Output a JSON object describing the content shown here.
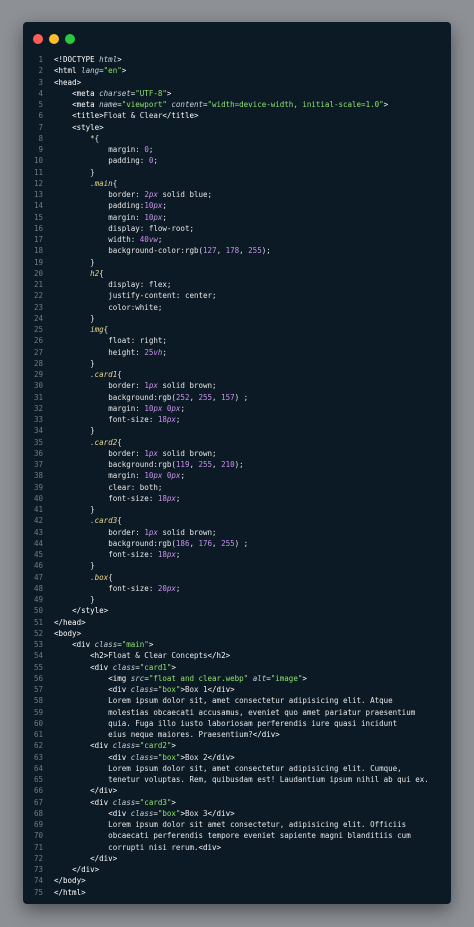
{
  "window": {
    "title": "",
    "traffic_lights": [
      {
        "name": "close",
        "color": "#ff5f57"
      },
      {
        "name": "minimize",
        "color": "#febc2e"
      },
      {
        "name": "maximize",
        "color": "#28c840"
      }
    ]
  },
  "colors": {
    "line_number": "#6b7b8c",
    "background": "#0c1a25",
    "string": "#8fe36f",
    "selector": "#e8d890",
    "number": "#c792ea"
  },
  "code_lines": [
    [
      [
        "tag",
        "<!DOCTYPE "
      ],
      [
        "attr",
        "html"
      ],
      [
        "tag",
        ">"
      ]
    ],
    [
      [
        "tag",
        "<html "
      ],
      [
        "attr",
        "lang"
      ],
      [
        "punct",
        "="
      ],
      [
        "str",
        "\"en\""
      ],
      [
        "tag",
        ">"
      ]
    ],
    [
      [
        "tag",
        "<head>"
      ]
    ],
    [
      [
        "plain",
        "    "
      ],
      [
        "tag",
        "<meta "
      ],
      [
        "attr",
        "charset"
      ],
      [
        "punct",
        "="
      ],
      [
        "str",
        "\"UTF-8\""
      ],
      [
        "tag",
        ">"
      ]
    ],
    [
      [
        "plain",
        "    "
      ],
      [
        "tag",
        "<meta "
      ],
      [
        "attr",
        "name"
      ],
      [
        "punct",
        "="
      ],
      [
        "str",
        "\"viewport\""
      ],
      [
        "plain",
        " "
      ],
      [
        "attr",
        "content"
      ],
      [
        "punct",
        "="
      ],
      [
        "str",
        "\"width=device-width, initial-scale=1.0\""
      ],
      [
        "tag",
        ">"
      ]
    ],
    [
      [
        "plain",
        "    "
      ],
      [
        "tag",
        "<title>"
      ],
      [
        "plain",
        "Float & Clear"
      ],
      [
        "tag",
        "</title>"
      ]
    ],
    [
      [
        "plain",
        "    "
      ],
      [
        "tag",
        "<style>"
      ]
    ],
    [
      [
        "plain",
        "        "
      ],
      [
        "sel",
        "*"
      ],
      [
        "punct",
        "{"
      ]
    ],
    [
      [
        "plain",
        "            "
      ],
      [
        "prop",
        "margin: "
      ],
      [
        "num",
        "0"
      ],
      [
        "punct",
        ";"
      ]
    ],
    [
      [
        "plain",
        "            "
      ],
      [
        "prop",
        "padding: "
      ],
      [
        "num",
        "0"
      ],
      [
        "punct",
        ";"
      ]
    ],
    [
      [
        "plain",
        "        "
      ],
      [
        "punct",
        "}"
      ]
    ],
    [
      [
        "plain",
        "        "
      ],
      [
        "sel",
        ".main"
      ],
      [
        "punct",
        "{"
      ]
    ],
    [
      [
        "plain",
        "            "
      ],
      [
        "prop",
        "border: "
      ],
      [
        "num",
        "2"
      ],
      [
        "unit",
        "px"
      ],
      [
        "prop",
        " solid blue;"
      ]
    ],
    [
      [
        "plain",
        "            "
      ],
      [
        "prop",
        "padding:"
      ],
      [
        "num",
        "10"
      ],
      [
        "unit",
        "px"
      ],
      [
        "punct",
        ";"
      ]
    ],
    [
      [
        "plain",
        "            "
      ],
      [
        "prop",
        "margin: "
      ],
      [
        "num",
        "10"
      ],
      [
        "unit",
        "px"
      ],
      [
        "punct",
        ";"
      ]
    ],
    [
      [
        "plain",
        "            "
      ],
      [
        "prop",
        "display: flow-root;"
      ]
    ],
    [
      [
        "plain",
        "            "
      ],
      [
        "prop",
        "width: "
      ],
      [
        "num",
        "40"
      ],
      [
        "unit",
        "vw"
      ],
      [
        "punct",
        ";"
      ]
    ],
    [
      [
        "plain",
        "            "
      ],
      [
        "prop",
        "background-color:rgb("
      ],
      [
        "num",
        "127"
      ],
      [
        "prop",
        ", "
      ],
      [
        "num",
        "178"
      ],
      [
        "prop",
        ", "
      ],
      [
        "num",
        "255"
      ],
      [
        "prop",
        ");"
      ]
    ],
    [
      [
        "plain",
        "        "
      ],
      [
        "punct",
        "}"
      ]
    ],
    [
      [
        "plain",
        "        "
      ],
      [
        "sel",
        "h2"
      ],
      [
        "punct",
        "{"
      ]
    ],
    [
      [
        "plain",
        "            "
      ],
      [
        "prop",
        "display: flex;"
      ]
    ],
    [
      [
        "plain",
        "            "
      ],
      [
        "prop",
        "justify-content: center;"
      ]
    ],
    [
      [
        "plain",
        "            "
      ],
      [
        "prop",
        "color:white;"
      ]
    ],
    [
      [
        "plain",
        "        "
      ],
      [
        "punct",
        "}"
      ]
    ],
    [
      [
        "plain",
        "        "
      ],
      [
        "sel",
        "img"
      ],
      [
        "punct",
        "{"
      ]
    ],
    [
      [
        "plain",
        "            "
      ],
      [
        "prop",
        "float: right;"
      ]
    ],
    [
      [
        "plain",
        "            "
      ],
      [
        "prop",
        "height: "
      ],
      [
        "num",
        "25"
      ],
      [
        "unit",
        "vh"
      ],
      [
        "punct",
        ";"
      ]
    ],
    [
      [
        "plain",
        "        "
      ],
      [
        "punct",
        "}"
      ]
    ],
    [
      [
        "plain",
        "        "
      ],
      [
        "sel",
        ".card1"
      ],
      [
        "punct",
        "{"
      ]
    ],
    [
      [
        "plain",
        "            "
      ],
      [
        "prop",
        "border: "
      ],
      [
        "num",
        "1"
      ],
      [
        "unit",
        "px"
      ],
      [
        "prop",
        " solid brown;"
      ]
    ],
    [
      [
        "plain",
        "            "
      ],
      [
        "prop",
        "background:rgb("
      ],
      [
        "num",
        "252"
      ],
      [
        "prop",
        ", "
      ],
      [
        "num",
        "255"
      ],
      [
        "prop",
        ", "
      ],
      [
        "num",
        "157"
      ],
      [
        "prop",
        ") ;"
      ]
    ],
    [
      [
        "plain",
        "            "
      ],
      [
        "prop",
        "margin: "
      ],
      [
        "num",
        "10"
      ],
      [
        "unit",
        "px"
      ],
      [
        "prop",
        " "
      ],
      [
        "num",
        "0"
      ],
      [
        "unit",
        "px"
      ],
      [
        "punct",
        ";"
      ]
    ],
    [
      [
        "plain",
        "            "
      ],
      [
        "prop",
        "font-size: "
      ],
      [
        "num",
        "18"
      ],
      [
        "unit",
        "px"
      ],
      [
        "punct",
        ";"
      ]
    ],
    [
      [
        "plain",
        "        "
      ],
      [
        "punct",
        "}"
      ]
    ],
    [
      [
        "plain",
        "        "
      ],
      [
        "sel",
        ".card2"
      ],
      [
        "punct",
        "{"
      ]
    ],
    [
      [
        "plain",
        "            "
      ],
      [
        "prop",
        "border: "
      ],
      [
        "num",
        "1"
      ],
      [
        "unit",
        "px"
      ],
      [
        "prop",
        " solid brown;"
      ]
    ],
    [
      [
        "plain",
        "            "
      ],
      [
        "prop",
        "background:rgb("
      ],
      [
        "num",
        "119"
      ],
      [
        "prop",
        ", "
      ],
      [
        "num",
        "255"
      ],
      [
        "prop",
        ", "
      ],
      [
        "num",
        "210"
      ],
      [
        "prop",
        ");"
      ]
    ],
    [
      [
        "plain",
        "            "
      ],
      [
        "prop",
        "margin: "
      ],
      [
        "num",
        "10"
      ],
      [
        "unit",
        "px"
      ],
      [
        "prop",
        " "
      ],
      [
        "num",
        "0"
      ],
      [
        "unit",
        "px"
      ],
      [
        "punct",
        ";"
      ]
    ],
    [
      [
        "plain",
        "            "
      ],
      [
        "prop",
        "clear: both;"
      ]
    ],
    [
      [
        "plain",
        "            "
      ],
      [
        "prop",
        "font-size: "
      ],
      [
        "num",
        "18"
      ],
      [
        "unit",
        "px"
      ],
      [
        "punct",
        ";"
      ]
    ],
    [
      [
        "plain",
        "        "
      ],
      [
        "punct",
        "}"
      ]
    ],
    [
      [
        "plain",
        "        "
      ],
      [
        "sel",
        ".card3"
      ],
      [
        "punct",
        "{"
      ]
    ],
    [
      [
        "plain",
        "            "
      ],
      [
        "prop",
        "border: "
      ],
      [
        "num",
        "1"
      ],
      [
        "unit",
        "px"
      ],
      [
        "prop",
        " solid brown;"
      ]
    ],
    [
      [
        "plain",
        "            "
      ],
      [
        "prop",
        "background:rgb("
      ],
      [
        "num",
        "186"
      ],
      [
        "prop",
        ", "
      ],
      [
        "num",
        "176"
      ],
      [
        "prop",
        ", "
      ],
      [
        "num",
        "255"
      ],
      [
        "prop",
        ") ;"
      ]
    ],
    [
      [
        "plain",
        "            "
      ],
      [
        "prop",
        "font-size: "
      ],
      [
        "num",
        "18"
      ],
      [
        "unit",
        "px"
      ],
      [
        "punct",
        ";"
      ]
    ],
    [
      [
        "plain",
        "        "
      ],
      [
        "punct",
        "}"
      ]
    ],
    [
      [
        "plain",
        "        "
      ],
      [
        "sel",
        ".box"
      ],
      [
        "punct",
        "{"
      ]
    ],
    [
      [
        "plain",
        "            "
      ],
      [
        "prop",
        "font-size: "
      ],
      [
        "num",
        "20"
      ],
      [
        "unit",
        "px"
      ],
      [
        "punct",
        ";"
      ]
    ],
    [
      [
        "plain",
        "        "
      ],
      [
        "punct",
        "}"
      ]
    ],
    [
      [
        "plain",
        "    "
      ],
      [
        "tag",
        "</style>"
      ]
    ],
    [
      [
        "tag",
        "</head>"
      ]
    ],
    [
      [
        "tag",
        "<body>"
      ]
    ],
    [
      [
        "plain",
        "    "
      ],
      [
        "tag",
        "<div "
      ],
      [
        "attr",
        "class"
      ],
      [
        "punct",
        "="
      ],
      [
        "str",
        "\"main\""
      ],
      [
        "tag",
        ">"
      ]
    ],
    [
      [
        "plain",
        "        "
      ],
      [
        "tag",
        "<h2>"
      ],
      [
        "plain",
        "Float & Clear Concepts"
      ],
      [
        "tag",
        "</h2>"
      ]
    ],
    [
      [
        "plain",
        "        "
      ],
      [
        "tag",
        "<div "
      ],
      [
        "attr",
        "class"
      ],
      [
        "punct",
        "="
      ],
      [
        "str",
        "\"card1\""
      ],
      [
        "tag",
        ">"
      ]
    ],
    [
      [
        "plain",
        "            "
      ],
      [
        "tag",
        "<img "
      ],
      [
        "attr",
        "src"
      ],
      [
        "punct",
        "="
      ],
      [
        "str",
        "\"float and clear.webp\""
      ],
      [
        "plain",
        " "
      ],
      [
        "attr",
        "alt"
      ],
      [
        "punct",
        "="
      ],
      [
        "str",
        "\"image\""
      ],
      [
        "tag",
        ">"
      ]
    ],
    [
      [
        "plain",
        "            "
      ],
      [
        "tag",
        "<div "
      ],
      [
        "attr",
        "class"
      ],
      [
        "punct",
        "="
      ],
      [
        "str",
        "\"box\""
      ],
      [
        "tag",
        ">"
      ],
      [
        "plain",
        "Box 1"
      ],
      [
        "tag",
        "</div>"
      ]
    ],
    [
      [
        "plain",
        "            Lorem ipsum dolor sit, amet consectetur adipisicing elit. Atque"
      ]
    ],
    [
      [
        "plain",
        "            molestias obcaecati accusamus, eveniet quo amet pariatur praesentium"
      ]
    ],
    [
      [
        "plain",
        "            quia. Fuga illo iusto laboriosam perferendis iure quasi incidunt"
      ]
    ],
    [
      [
        "plain",
        "            eius neque maiores. Praesentium?"
      ],
      [
        "tag",
        "</div>"
      ]
    ],
    [
      [
        "plain",
        "        "
      ],
      [
        "tag",
        "<div "
      ],
      [
        "attr",
        "class"
      ],
      [
        "punct",
        "="
      ],
      [
        "str",
        "\"card2\""
      ],
      [
        "tag",
        ">"
      ]
    ],
    [
      [
        "plain",
        "            "
      ],
      [
        "tag",
        "<div "
      ],
      [
        "attr",
        "class"
      ],
      [
        "punct",
        "="
      ],
      [
        "str",
        "\"box\""
      ],
      [
        "tag",
        ">"
      ],
      [
        "plain",
        "Box 2"
      ],
      [
        "tag",
        "</div>"
      ]
    ],
    [
      [
        "plain",
        "            Lorem ipsum dolor sit, amet consectetur adipisicing elit. Cumque,"
      ]
    ],
    [
      [
        "plain",
        "            tenetur voluptas. Rem, quibusdam est! Laudantium ipsum nihil ab qui ex."
      ]
    ],
    [
      [
        "plain",
        "        "
      ],
      [
        "tag",
        "</div>"
      ]
    ],
    [
      [
        "plain",
        "        "
      ],
      [
        "tag",
        "<div "
      ],
      [
        "attr",
        "class"
      ],
      [
        "punct",
        "="
      ],
      [
        "str",
        "\"card3\""
      ],
      [
        "tag",
        ">"
      ]
    ],
    [
      [
        "plain",
        "            "
      ],
      [
        "tag",
        "<div "
      ],
      [
        "attr",
        "class"
      ],
      [
        "punct",
        "="
      ],
      [
        "str",
        "\"box\""
      ],
      [
        "tag",
        ">"
      ],
      [
        "plain",
        "Box 3"
      ],
      [
        "tag",
        "</div>"
      ]
    ],
    [
      [
        "plain",
        "            Lorem ipsum dolor sit amet consectetur, adipisicing elit. Officiis"
      ]
    ],
    [
      [
        "plain",
        "            obcaecati perferendis tempore eveniet sapiente magni blanditiis cum"
      ]
    ],
    [
      [
        "plain",
        "            corrupti nisi rerum."
      ],
      [
        "tag",
        "<div>"
      ]
    ],
    [
      [
        "plain",
        "        "
      ],
      [
        "tag",
        "</div>"
      ]
    ],
    [
      [
        "plain",
        "    "
      ],
      [
        "tag",
        "</div>"
      ]
    ],
    [
      [
        "tag",
        "</body>"
      ]
    ],
    [
      [
        "tag",
        "</html>"
      ]
    ]
  ]
}
